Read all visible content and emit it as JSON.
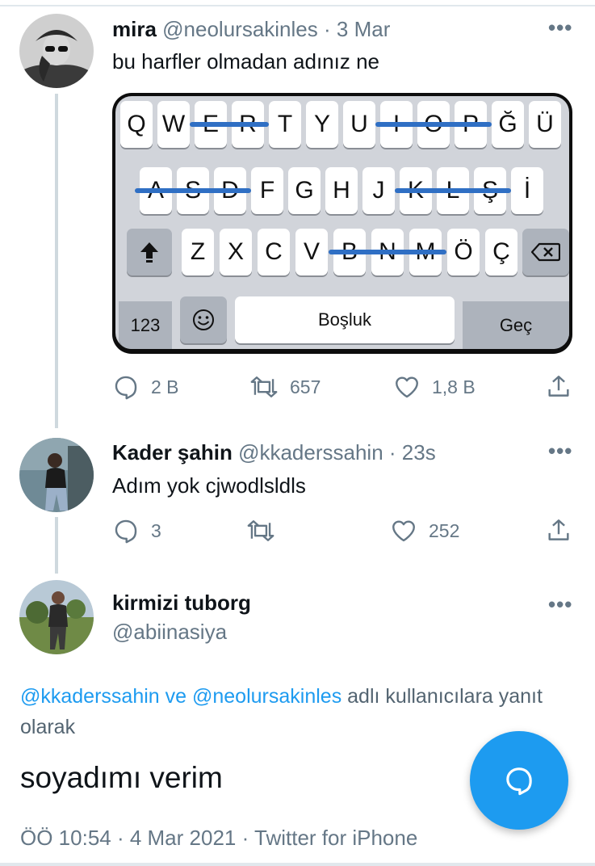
{
  "tweet1": {
    "name": "mira",
    "handle": "@neolursakinles",
    "date": "3 Mar",
    "text": "bu harfler olmadan adınız ne",
    "keyboard": {
      "row1": [
        "Q",
        "W",
        "E",
        "R",
        "T",
        "Y",
        "U",
        "I",
        "O",
        "P",
        "Ğ",
        "Ü"
      ],
      "row2": [
        "A",
        "S",
        "D",
        "F",
        "G",
        "H",
        "J",
        "K",
        "L",
        "Ş",
        "İ"
      ],
      "row3": [
        "Z",
        "X",
        "C",
        "V",
        "B",
        "N",
        "M",
        "Ö",
        "Ç"
      ],
      "numbers_label": "123",
      "space_label": "Boşluk",
      "return_label": "Geç",
      "struck_letters": [
        "E",
        "R",
        "I",
        "O",
        "P",
        "A",
        "S",
        "D",
        "K",
        "L",
        "Ş",
        "B",
        "N",
        "M"
      ]
    },
    "stats": {
      "replies": "2 B",
      "retweets": "657",
      "likes": "1,8 B"
    }
  },
  "tweet2": {
    "name": "Kader şahin",
    "handle": "@kkaderssahin",
    "date": "23s",
    "text": "Adım yok cjwodlsldls",
    "stats": {
      "replies": "3",
      "retweets": "",
      "likes": "252"
    }
  },
  "main": {
    "name": "kirmizi tuborg",
    "handle": "@abiinasiya",
    "reply_mention1": "@kkaderssahin",
    "reply_ve": "ve",
    "reply_mention2": "@neolursakinles",
    "reply_suffix": "adlı kullanıcılara yanıt olarak",
    "text": "soyadımı verim",
    "footer": "ÖÖ 10:54 · 4 Mar 2021 · Twitter for iPhone"
  },
  "more_label": "•••",
  "colors": {
    "accent": "#1d9bf0",
    "muted": "#657786",
    "strike": "#2f6fc4"
  }
}
